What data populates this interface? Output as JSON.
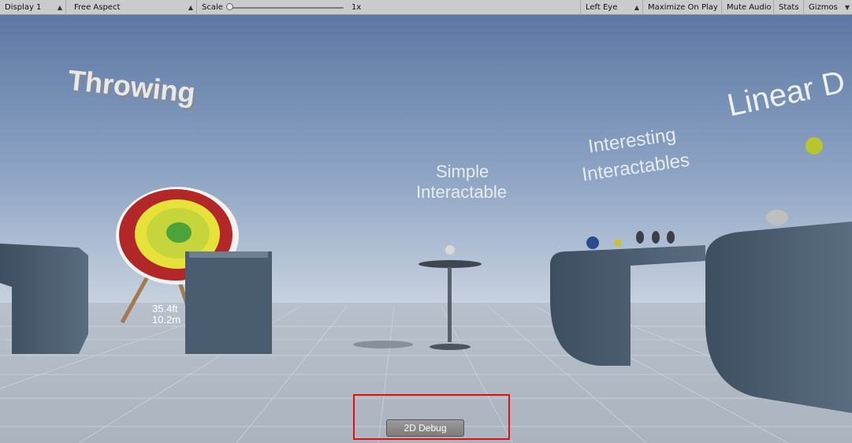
{
  "toolbar": {
    "display": "Display 1",
    "aspect": "Free Aspect",
    "scale_label": "Scale",
    "scale_value": "1x",
    "eye": "Left Eye",
    "maximize": "Maximize On Play",
    "mute": "Mute Audio",
    "stats": "Stats",
    "gizmos": "Gizmos"
  },
  "scene": {
    "throwing": "Throwing",
    "simple_1": "Simple",
    "simple_2": "Interactable",
    "interesting_1": "Interesting",
    "interesting_2": "Interactables",
    "linear": "Linear D",
    "distance_ft": "35.4ft",
    "distance_m": "10.2m"
  },
  "debug_button": "2D Debug"
}
